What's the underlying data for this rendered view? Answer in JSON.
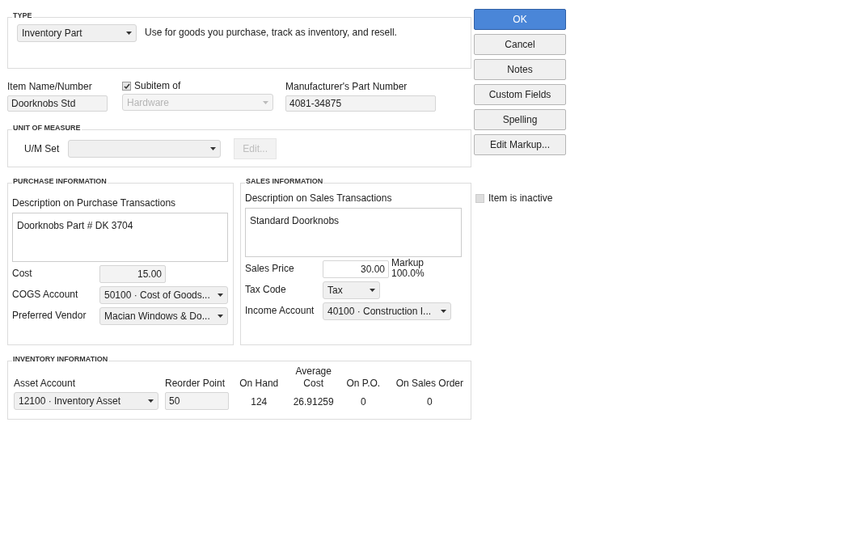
{
  "type_section": {
    "title": "TYPE",
    "type_select": "Inventory Part",
    "description": "Use for goods you purchase, track as inventory, and resell."
  },
  "item_name": {
    "label": "Item Name/Number",
    "value": "Doorknobs Std"
  },
  "subitem": {
    "label": "Subitem of",
    "checked": true,
    "value": "Hardware",
    "disabled": true
  },
  "manufacturer_part": {
    "label": "Manufacturer's Part Number",
    "value": "4081-34875"
  },
  "unit_of_measure": {
    "title": "UNIT OF MEASURE",
    "label": "U/M Set",
    "edit_button": {
      "label": "Edit...",
      "disabled": true
    }
  },
  "purchase": {
    "title": "PURCHASE INFORMATION",
    "description_label": "Description on Purchase Transactions",
    "description": "Doorknobs Part # DK 3704",
    "fields": [
      {
        "kind": "number",
        "label": "Cost",
        "value": "15.00"
      },
      {
        "kind": "select",
        "label": "COGS Account",
        "value": "50100 · Cost of Goods..."
      },
      {
        "kind": "select",
        "label": "Preferred Vendor",
        "value": "Macian Windows & Do..."
      }
    ]
  },
  "sales": {
    "title": "SALES INFORMATION",
    "description_label": "Description on Sales Transactions",
    "description": "Standard Doorknobs",
    "fields": [
      {
        "kind": "price",
        "label": "Sales Price",
        "value": "30.00",
        "markup_label": "Markup",
        "markup_value": "100.0%"
      },
      {
        "kind": "short_select",
        "label": "Tax Code",
        "value": "Tax"
      },
      {
        "kind": "select",
        "label": "Income Account",
        "value": "40100 · Construction I..."
      }
    ]
  },
  "inventory": {
    "title": "INVENTORY INFORMATION",
    "asset_account": {
      "label": "Asset Account",
      "value": "12100 · Inventory Asset"
    },
    "reorder_point": {
      "label": "Reorder Point",
      "value": "50"
    },
    "stats": [
      {
        "label": "On Hand",
        "value": "124"
      },
      {
        "label": "Average Cost",
        "value": "26.91259"
      },
      {
        "label": "On P.O.",
        "value": "0"
      },
      {
        "label": "On Sales Order",
        "value": "0"
      }
    ]
  },
  "buttons": [
    {
      "label": "OK",
      "primary": true
    },
    {
      "label": "Cancel",
      "primary": false
    },
    {
      "label": "Notes",
      "primary": false
    },
    {
      "label": "Custom Fields",
      "primary": false
    },
    {
      "label": "Spelling",
      "primary": false
    },
    {
      "label": "Edit Markup...",
      "primary": false
    }
  ],
  "inactive": {
    "label": "Item is inactive",
    "checked": false,
    "disabled": true
  }
}
